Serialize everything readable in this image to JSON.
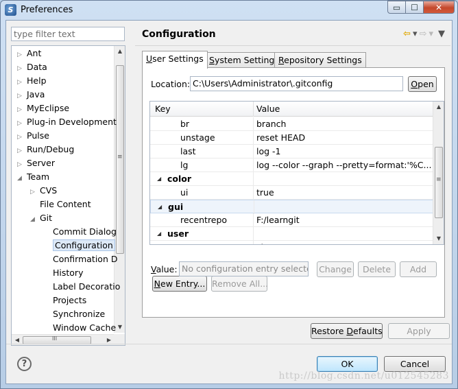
{
  "window": {
    "title": "Preferences",
    "app_icon": "eclipse-icon"
  },
  "caption": {
    "minimize": "▭",
    "maximize": "☐",
    "close": "✕"
  },
  "sidebar": {
    "filter_placeholder": "type filter text",
    "items": [
      {
        "label": "Ant",
        "twisty": "▷",
        "depth": 0
      },
      {
        "label": "Data",
        "twisty": "▷",
        "depth": 0
      },
      {
        "label": "Help",
        "twisty": "▷",
        "depth": 0
      },
      {
        "label": "Java",
        "twisty": "▷",
        "depth": 0
      },
      {
        "label": "MyEclipse",
        "twisty": "▷",
        "depth": 0
      },
      {
        "label": "Plug-in Development",
        "twisty": "▷",
        "depth": 0
      },
      {
        "label": "Pulse",
        "twisty": "▷",
        "depth": 0
      },
      {
        "label": "Run/Debug",
        "twisty": "▷",
        "depth": 0
      },
      {
        "label": "Server",
        "twisty": "▷",
        "depth": 0
      },
      {
        "label": "Team",
        "twisty": "◢",
        "depth": 0
      },
      {
        "label": "CVS",
        "twisty": "▷",
        "depth": 1
      },
      {
        "label": "File Content",
        "twisty": "",
        "depth": 1
      },
      {
        "label": "Git",
        "twisty": "◢",
        "depth": 1
      },
      {
        "label": "Commit Dialog",
        "twisty": "",
        "depth": 2
      },
      {
        "label": "Configuration",
        "twisty": "",
        "depth": 2,
        "selected": true
      },
      {
        "label": "Confirmation D",
        "twisty": "",
        "depth": 2
      },
      {
        "label": "History",
        "twisty": "",
        "depth": 2
      },
      {
        "label": "Label Decoratio",
        "twisty": "",
        "depth": 2
      },
      {
        "label": "Projects",
        "twisty": "",
        "depth": 2
      },
      {
        "label": "Synchronize",
        "twisty": "",
        "depth": 2
      },
      {
        "label": "Window Cache",
        "twisty": "",
        "depth": 2
      }
    ],
    "scroll_up": "▲",
    "scroll_down": "▼",
    "scroll_left": "◀",
    "scroll_right": "▶",
    "thumb_grip": "≡",
    "hthumb_grip": "III"
  },
  "page": {
    "title": "Configuration",
    "nav_back": "⇦",
    "nav_fwd": "⇨",
    "nav_dropdown": "▾",
    "nav_menu": "▼"
  },
  "tabs": [
    {
      "label": "User Settings",
      "accel": "U",
      "rest": "ser Settings",
      "active": true
    },
    {
      "label": "System Settings",
      "accel": "S",
      "rest": "ystem Settings",
      "active": false
    },
    {
      "label": "Repository Settings",
      "accel": "R",
      "rest": "epository Settings",
      "active": false
    }
  ],
  "location": {
    "label": "Location:",
    "value": "C:\\Users\\Administrator\\.gitconfig",
    "open_button": "Open",
    "open_accel": "O",
    "open_rest": "pen"
  },
  "grid": {
    "headers": {
      "key": "Key",
      "value": "Value"
    },
    "rows": [
      {
        "key": "br",
        "value": "branch",
        "type": "entry"
      },
      {
        "key": "unstage",
        "value": "reset HEAD",
        "type": "entry"
      },
      {
        "key": "last",
        "value": "log -1",
        "type": "entry"
      },
      {
        "key": "lg",
        "value": "log --color --graph --pretty=format:'%C...",
        "type": "entry"
      },
      {
        "key": "color",
        "value": "",
        "type": "section",
        "twisty": "◢"
      },
      {
        "key": "ui",
        "value": "true",
        "type": "entry"
      },
      {
        "key": "gui",
        "value": "",
        "type": "section",
        "twisty": "◢",
        "selected": true
      },
      {
        "key": "recentrepo",
        "value": "F:/learngit",
        "type": "entry"
      },
      {
        "key": "user",
        "value": "",
        "type": "section",
        "twisty": "◢"
      },
      {
        "key": "",
        "value": "zl",
        "type": "entry"
      }
    ],
    "scroll_up": "▲",
    "scroll_down": "▼",
    "thumb_grip": "≡"
  },
  "entry_buttons": {
    "new_entry": "New Entry...",
    "new_entry_accel": "N",
    "new_entry_rest": "ew Entry...",
    "remove_all": "Remove All..."
  },
  "value_row": {
    "label": "Value:",
    "accel": "V",
    "rest": "alue:",
    "placeholder": "No configuration entry selected",
    "change": "Change",
    "delete": "Delete",
    "add": "Add"
  },
  "footer": {
    "restore_defaults": "Restore Defaults",
    "restore_pre": "Restore ",
    "restore_accel": "D",
    "restore_post": "efaults",
    "apply": "Apply",
    "ok": "OK",
    "cancel": "Cancel",
    "help": "?",
    "watermark": "http://blog.csdn.net/u012545283"
  }
}
